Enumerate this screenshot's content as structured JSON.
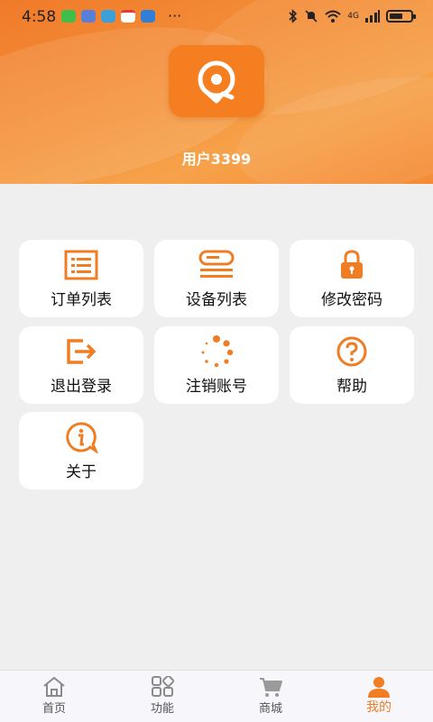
{
  "status_bar": {
    "time": "4:58",
    "more": "···",
    "network": "4G"
  },
  "profile": {
    "username": "用户3399"
  },
  "menu": {
    "items": [
      {
        "label": "订单列表",
        "icon": "order-list-icon"
      },
      {
        "label": "设备列表",
        "icon": "device-list-icon"
      },
      {
        "label": "修改密码",
        "icon": "lock-icon"
      },
      {
        "label": "退出登录",
        "icon": "logout-icon"
      },
      {
        "label": "注销账号",
        "icon": "loading-dots-icon"
      },
      {
        "label": "帮助",
        "icon": "help-icon"
      },
      {
        "label": "关于",
        "icon": "info-icon"
      }
    ]
  },
  "bottom_nav": {
    "items": [
      {
        "label": "首页",
        "icon": "home-icon"
      },
      {
        "label": "功能",
        "icon": "apps-grid-icon"
      },
      {
        "label": "商城",
        "icon": "cart-icon"
      },
      {
        "label": "我的",
        "icon": "user-icon"
      }
    ],
    "active": "我的"
  },
  "colors": {
    "accent": "#f07d24",
    "background": "#efefef",
    "card": "#ffffff"
  }
}
